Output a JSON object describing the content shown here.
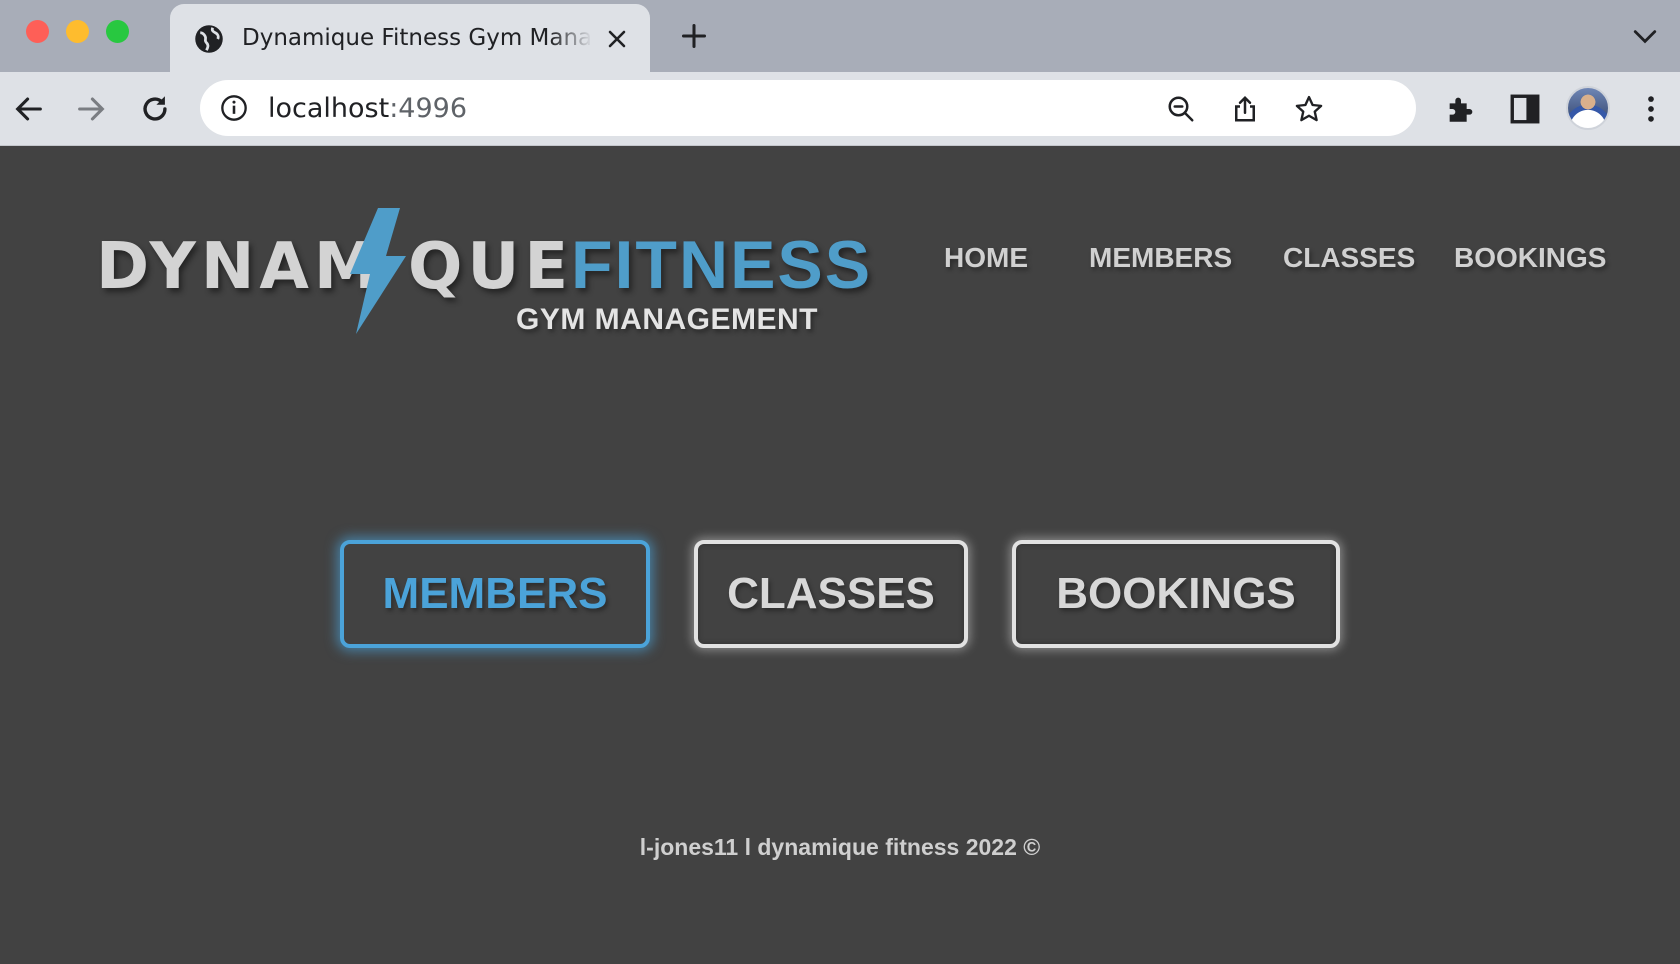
{
  "browser": {
    "tab_title": "Dynamique Fitness Gym Management",
    "url_host": "localhost",
    "url_port": ":4996"
  },
  "logo": {
    "word_left": "DYNAM",
    "word_right": "QUE",
    "word_fitness": "FITNESS",
    "subtitle": "GYM MANAGEMENT"
  },
  "nav": {
    "home": "HOME",
    "members": "MEMBERS",
    "classes": "CLASSES",
    "bookings": "BOOKINGS"
  },
  "buttons": {
    "members": "MEMBERS",
    "classes": "CLASSES",
    "bookings": "BOOKINGS"
  },
  "footer": {
    "text": "l-jones11 l dynamique fitness 2022 ©"
  },
  "colors": {
    "accent": "#4ba3d9",
    "background": "#424242",
    "text_light": "#d3d3d3"
  },
  "icons": [
    "globe-icon",
    "close-icon",
    "plus-icon",
    "chevron-down-icon",
    "back-icon",
    "forward-icon",
    "reload-icon",
    "info-icon",
    "zoom-icon",
    "share-icon",
    "star-icon",
    "extensions-icon",
    "side-panel-icon",
    "more-icon",
    "lightning-bolt-icon"
  ]
}
